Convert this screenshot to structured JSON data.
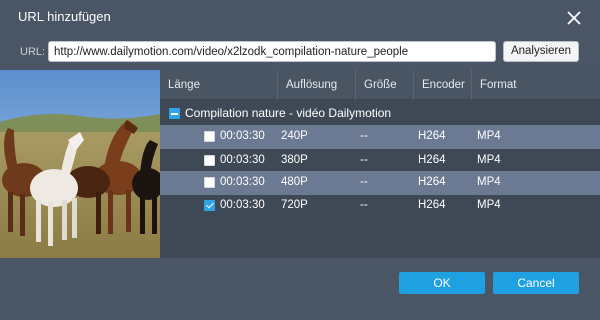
{
  "window": {
    "title": "URL hinzufügen"
  },
  "url_bar": {
    "label": "URL:",
    "value": "http://www.dailymotion.com/video/x2lzodk_compilation-nature_people",
    "analyze_label": "Analysieren"
  },
  "table": {
    "headers": [
      "Länge",
      "Auflösung",
      "Größe",
      "Encoder",
      "Format"
    ],
    "group": {
      "label": "Compilation nature - vidéo Dailymotion",
      "expanded": true
    },
    "rows": [
      {
        "length": "00:03:30",
        "resolution": "240P",
        "size": "--",
        "encoder": "H264",
        "format": "MP4",
        "checked": false
      },
      {
        "length": "00:03:30",
        "resolution": "380P",
        "size": "--",
        "encoder": "H264",
        "format": "MP4",
        "checked": false
      },
      {
        "length": "00:03:30",
        "resolution": "480P",
        "size": "--",
        "encoder": "H264",
        "format": "MP4",
        "checked": false
      },
      {
        "length": "00:03:30",
        "resolution": "720P",
        "size": "--",
        "encoder": "H264",
        "format": "MP4",
        "checked": true
      }
    ]
  },
  "buttons": {
    "ok": "OK",
    "cancel": "Cancel"
  },
  "colors": {
    "background": "#4a5565",
    "accent": "#1fa0e0",
    "stripe": "#6b7a92",
    "table_bg": "#3f4956"
  },
  "icons": {
    "close": "close-icon"
  }
}
